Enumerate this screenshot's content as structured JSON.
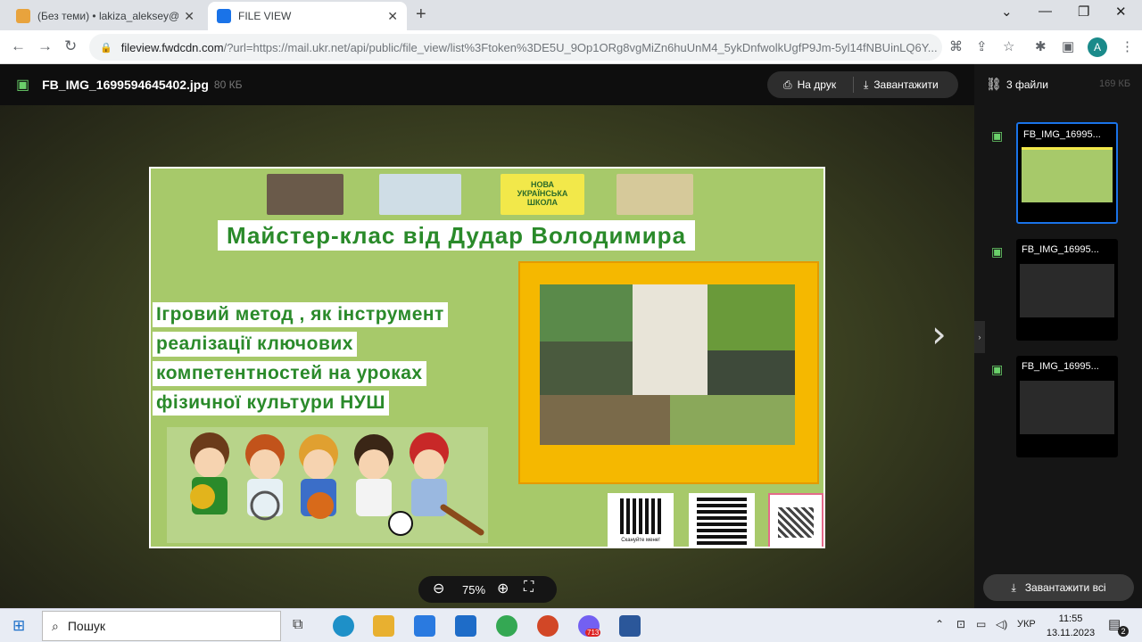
{
  "browser": {
    "tabs": [
      {
        "title": "(Без теми) • lakiza_aleksey@ukr.",
        "active": false
      },
      {
        "title": "FILE VIEW",
        "active": true
      }
    ],
    "url_host": "fileview.fwdcdn.com",
    "url_path": "/?url=https://mail.ukr.net/api/public/file_view/list%3Ftoken%3DE5U_9Op1ORg8vgMiZn6huUnM4_5ykDnfwolkUgfP9Jm-5yl14fNBUinLQ6Y...",
    "profile_initial": "A"
  },
  "viewer": {
    "file_name": "FB_IMG_1699594645402.jpg",
    "file_size": "80 КБ",
    "print_label": "На друк",
    "download_label": "Завантажити",
    "zoom": "75%"
  },
  "slide": {
    "logo_text": "НОВА УКРАЇНСЬКА ШКОЛА",
    "title": "Майстер-клас від Дудар Володимира",
    "subtitle_lines": [
      "Ігровий метод , як інструмент",
      "реалізації ключових",
      "компетентностей на уроках",
      "фізичної культури НУШ"
    ],
    "qr_caption": "Скануйте мене!"
  },
  "panel": {
    "files_label": "3 файли",
    "total_size": "169 КБ",
    "thumbs": [
      "FB_IMG_16995...",
      "FB_IMG_16995...",
      "FB_IMG_16995..."
    ],
    "download_all": "Завантажити всі"
  },
  "taskbar": {
    "search_placeholder": "Пошук",
    "lang": "УКР",
    "time": "11:55",
    "date": "13.11.2023",
    "notif_count": "2",
    "viber_badge": "713"
  },
  "colors": {
    "accent": "#1a73e8",
    "slide_bg": "#a7c96a",
    "title_green": "#2a8a2a",
    "frame_orange": "#f5b800"
  }
}
